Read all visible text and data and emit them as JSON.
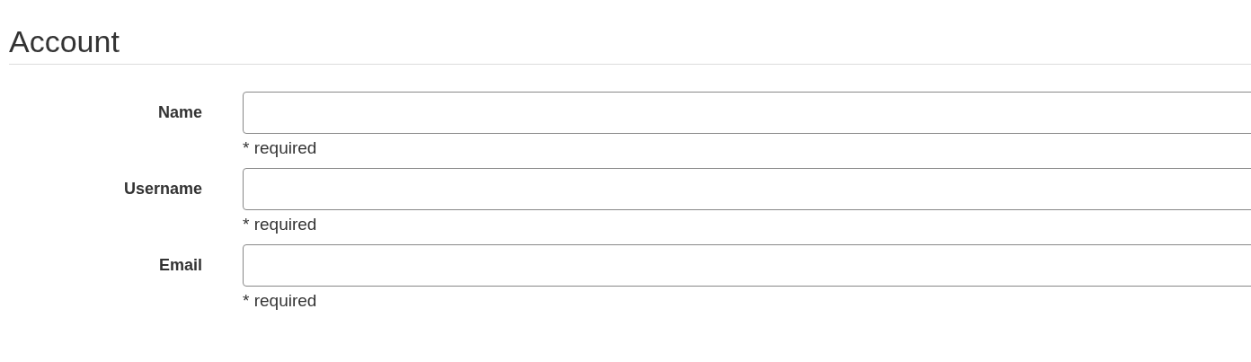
{
  "heading": "Account",
  "fields": [
    {
      "label": "Name",
      "help": "* required"
    },
    {
      "label": "Username",
      "help": "* required"
    },
    {
      "label": "Email",
      "help": "* required"
    }
  ]
}
